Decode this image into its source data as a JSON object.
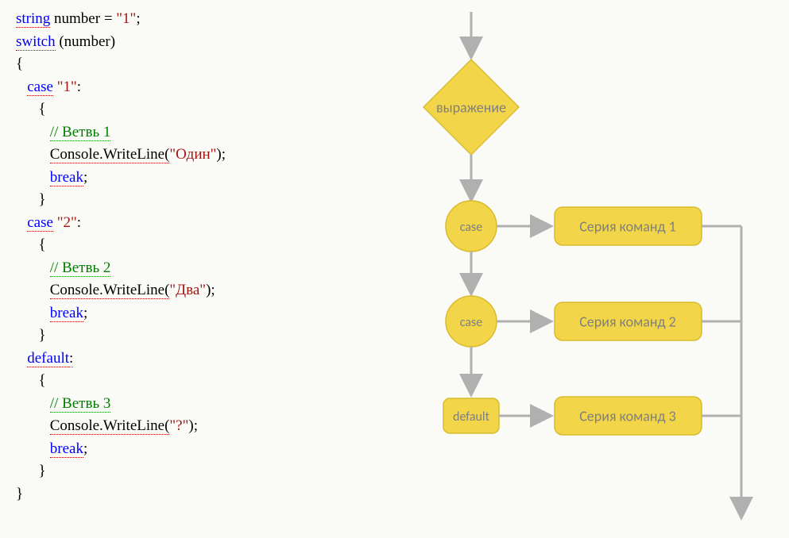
{
  "code": {
    "l1_kw": "string",
    "l1_rest": " number = ",
    "l1_str": "\"1\"",
    "l1_semi": ";",
    "l2_kw": "switch",
    "l2_rest": " (number)",
    "brace_open": "{",
    "brace_close": "}",
    "case1_kw": "case",
    "case1_val": " \"1\"",
    "case1_colon": ":",
    "case1_cmt": "// Ветвь 1",
    "case1_call": "Console.WriteLine(",
    "case1_arg": "\"Один\"",
    "case1_end": ");",
    "break_kw": "break",
    "semi": ";",
    "case2_kw": "case",
    "case2_val": " \"2\"",
    "case2_colon": ":",
    "case2_cmt": "// Ветвь 2",
    "case2_call": "Console.WriteLine(",
    "case2_arg": "\"Два\"",
    "case2_end": ");",
    "default_kw": "default",
    "default_colon": ":",
    "default_cmt": "// Ветвь 3",
    "default_call": "Console.WriteLine(",
    "default_arg": "\"?\"",
    "default_end": ");"
  },
  "diagram": {
    "expr": "выражение",
    "case": "case",
    "default": "default",
    "cmd1": "Серия команд 1",
    "cmd2": "Серия команд 2",
    "cmd3": "Серия команд 3"
  }
}
